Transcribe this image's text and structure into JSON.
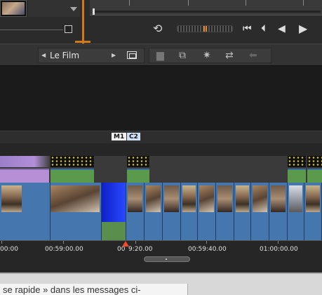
{
  "toolbar": {
    "project_title": "Le Film"
  },
  "markers": [
    {
      "label": "M1"
    },
    {
      "label": "C2"
    }
  ],
  "ruler": {
    "timecodes": [
      "00:00",
      "00:59:00.00",
      "00:59:20.00",
      "00:59:40.00",
      "01:00:00.00"
    ],
    "playhead_label_start": "00",
    "playhead_label_end": "9:20.00"
  },
  "forum": {
    "text": "se rapide » dans les messages ci-"
  },
  "colors": {
    "accent": "#d07a1a",
    "playhead": "#f04a2a",
    "video_track": "#3d6fa8",
    "audio_track": "#5b9a4c"
  },
  "icons": {
    "loop": "loop-icon",
    "skip_start": "skip-start-icon",
    "prev_frame": "prev-frame-icon",
    "step_back": "step-back-icon",
    "play": "play-icon",
    "storyboard": "storyboard-icon"
  }
}
